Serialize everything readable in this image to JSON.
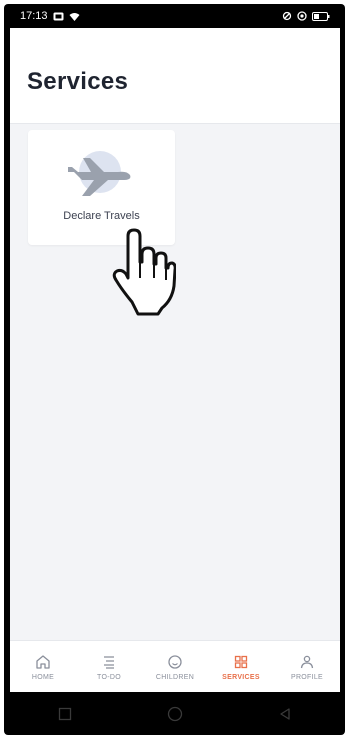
{
  "status_bar": {
    "time": "17:13"
  },
  "page": {
    "title": "Services"
  },
  "services": [
    {
      "label": "Declare Travels",
      "icon": "airplane-icon"
    }
  ],
  "tabs": [
    {
      "label": "HOME",
      "icon": "home-icon"
    },
    {
      "label": "TO-DO",
      "icon": "todo-list-icon"
    },
    {
      "label": "CHILDREN",
      "icon": "smiley-face-icon"
    },
    {
      "label": "SERVICES",
      "icon": "grid-icon",
      "active": true
    },
    {
      "label": "PROFILE",
      "icon": "person-icon"
    }
  ],
  "colors": {
    "accent": "#e8704a",
    "background": "#f3f4f7",
    "tab_inactive": "#8a8f9b"
  }
}
